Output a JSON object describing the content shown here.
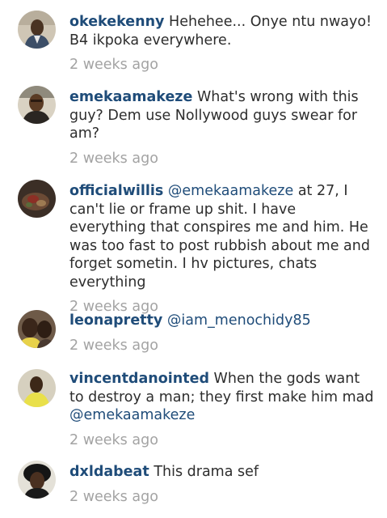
{
  "comments": [
    {
      "username": "okekekenny",
      "text": "Hehehee... Onye ntu nwayo! B4 ikpoka everywhere.",
      "time": "2 weeks ago"
    },
    {
      "username": "emekaamakeze",
      "text": "What's wrong with this guy? Dem use Nollywood guys swear for am?",
      "time": "2 weeks ago"
    },
    {
      "username": "officialwillis",
      "mention": "@emekaamakeze",
      "text": "at 27, I can't lie or frame up shit. I have everything that conspires me and him. He was too fast to post rubbish about me and forget sometin. I hv pictures, chats everything",
      "time": "2 weeks ago"
    },
    {
      "username": "leonapretty",
      "mention": "@iam_menochidy85",
      "time": "2 weeks ago"
    },
    {
      "username": "vincentdanointed",
      "text": "When the gods want to destroy a man; they first make him mad",
      "mention": "@emekaamakeze",
      "time": "2 weeks ago"
    },
    {
      "username": "dxldabeat",
      "text": "This drama sef",
      "time": "2 weeks ago"
    }
  ]
}
